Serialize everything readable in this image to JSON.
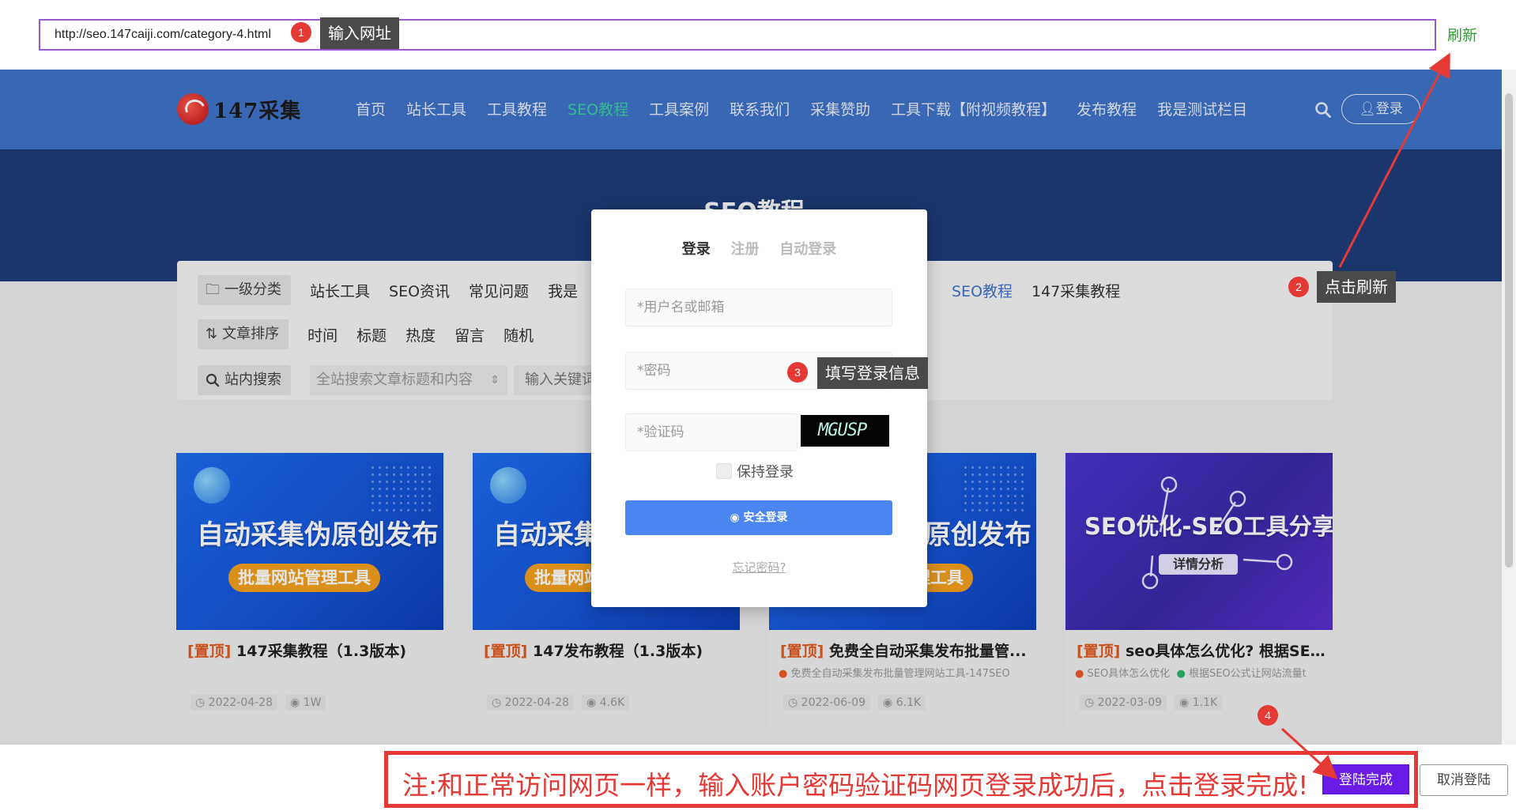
{
  "url_bar": {
    "value": "http://seo.147caiji.com/category-4.html",
    "refresh_label": "刷新"
  },
  "steps": [
    {
      "num": "1",
      "tip": "输入网址"
    },
    {
      "num": "2",
      "tip": "点击刷新"
    },
    {
      "num": "3",
      "tip": "填写登录信息"
    },
    {
      "num": "4"
    }
  ],
  "site": {
    "logo_text": "147采集",
    "nav": [
      "首页",
      "站长工具",
      "工具教程",
      "SEO教程",
      "工具案例",
      "联系我们",
      "采集赞助",
      "工具下载【附视频教程】",
      "发布教程",
      "我是测试栏目"
    ],
    "nav_active": "SEO教程",
    "login_button": "登录",
    "banner_title": "SEO教程",
    "filters": {
      "category_label": "一级分类",
      "categories_left": [
        "站长工具",
        "SEO资讯",
        "常见问题",
        "我是"
      ],
      "categories_right": [
        "SEO教程",
        "147采集教程"
      ],
      "sort_label": "文章排序",
      "sorts": [
        "时间",
        "标题",
        "热度",
        "留言",
        "随机"
      ],
      "search_label": "站内搜索",
      "search_select": "全站搜索文章标题和内容",
      "search_keyword": "输入关键词"
    },
    "cards": [
      {
        "img_title": "自动采集伪原创发布",
        "img_pill": "批量网站管理工具",
        "pin": "[置顶]",
        "title": "147采集教程（1.3版本)",
        "tags": [],
        "date": "2022-04-28",
        "views": "1W"
      },
      {
        "img_title": "自动采集伪原创发布",
        "img_pill": "批量网站管理工具",
        "pin": "[置顶]",
        "title": "147发布教程（1.3版本)",
        "tags": [],
        "date": "2022-04-28",
        "views": "4.6K"
      },
      {
        "img_title": "自动采集伪原创发布",
        "img_pill": "批量网站管理工具",
        "pin": "[置顶]",
        "title": "免费全自动采集发布批量管...",
        "tags": [
          "免费全自动采集发布批量管理网站工具-147SEO"
        ],
        "date": "2022-06-09",
        "views": "6.1K"
      },
      {
        "img_title": "SEO优化-SEO工具分享",
        "img_pill": "详情分析",
        "pin": "[置顶]",
        "title": "seo具体怎么优化? 根据SEO...",
        "tags": [
          "SEO具体怎么优化",
          "根据SEO公式让网站流量t"
        ],
        "date": "2022-03-09",
        "views": "1.1K"
      }
    ]
  },
  "login_modal": {
    "tabs": [
      "登录",
      "注册",
      "自动登录"
    ],
    "username_placeholder": "*用户名或邮箱",
    "password_placeholder": "*密码",
    "captcha_placeholder": "*验证码",
    "captcha_text": "MGUSP",
    "keep_login": "保持登录",
    "submit": "安全登录",
    "forgot": "忘记密码?"
  },
  "bottom_bar": {
    "note": "注:和正常访问网页一样，输入账户密码验证码网页登录成功后，点击登录完成!",
    "done_button": "登陆完成",
    "cancel_button": "取消登陆"
  },
  "colors": {
    "header_blue": "#3f73c9",
    "banner_navy": "#1d3d7a",
    "accent_red": "#e53935",
    "done_purple": "#6a1be6",
    "refresh_green": "#2aa52a",
    "url_border": "#9b59d6"
  }
}
